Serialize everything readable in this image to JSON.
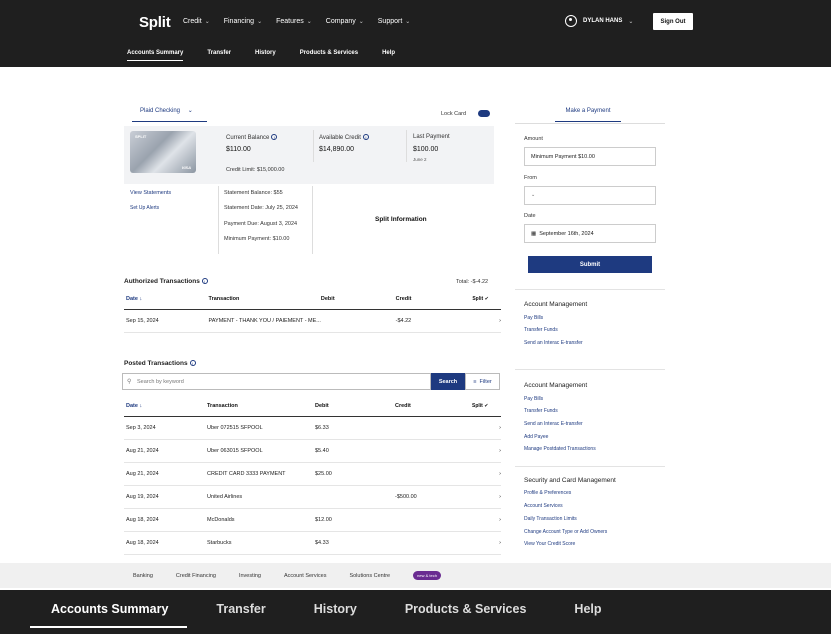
{
  "header": {
    "logo": "Split",
    "nav": [
      "Credit",
      "Financing",
      "Features",
      "Company",
      "Support"
    ],
    "user_name": "DYLAN HANS",
    "sign_out": "Sign Out"
  },
  "subnav": [
    "Accounts Summary",
    "Transfer",
    "History",
    "Products & Services",
    "Help"
  ],
  "account": {
    "selected": "Plaid Checking",
    "lock_card": "Lock Card",
    "card_brand": "SPLIT",
    "card_network": "VISA",
    "current_balance_label": "Current Balance",
    "current_balance": "$110.00",
    "credit_limit": "Credit Limit: $15,000.00",
    "available_credit_label": "Available Credit",
    "available_credit": "$14,890.00",
    "last_payment_label": "Last Payment",
    "last_payment": "$100.00",
    "last_payment_date": "June 2",
    "view_statements": "View Statements",
    "set_up_alerts": "Set Up Alerts",
    "statement_balance": "Statement Balance: $55",
    "statement_date": "Statement Date: July 25, 2024",
    "payment_due": "Payment Due: August 3, 2024",
    "minimum_payment": "Minimum Payment: $10.00",
    "split_information": "Split Information"
  },
  "authorized": {
    "title": "Authorized Transactions",
    "total": "Total: -$-4.22",
    "headers": [
      "Date ↓",
      "Transaction",
      "Debit",
      "Credit",
      "Split ✔"
    ],
    "rows": [
      {
        "date": "Sep 15, 2024",
        "transaction": "PAYMENT - THANK YOU / PAIEMENT - ME...",
        "debit": "",
        "credit": "-$4.22"
      }
    ]
  },
  "posted": {
    "title": "Posted Transactions",
    "search_placeholder": "Search by keyword",
    "search_button": "Search",
    "filter_button": "Filter",
    "headers": [
      "Date ↓",
      "Transaction",
      "Debit",
      "Credit",
      "Split ✔"
    ],
    "rows": [
      {
        "date": "Sep 3, 2024",
        "transaction": "Uber 072515 SFPOOL",
        "debit": "$6.33",
        "credit": ""
      },
      {
        "date": "Aug 21, 2024",
        "transaction": "Uber 063015 SFPOOL",
        "debit": "$5.40",
        "credit": ""
      },
      {
        "date": "Aug 21, 2024",
        "transaction": "CREDIT CARD 3333 PAYMENT",
        "debit": "$25.00",
        "credit": ""
      },
      {
        "date": "Aug 19, 2024",
        "transaction": "United Airlines",
        "debit": "",
        "credit": "-$500.00"
      },
      {
        "date": "Aug 18, 2024",
        "transaction": "McDonalds",
        "debit": "$12.00",
        "credit": ""
      },
      {
        "date": "Aug 18, 2024",
        "transaction": "Starbucks",
        "debit": "$4.33",
        "credit": ""
      }
    ]
  },
  "payment": {
    "tab": "Make a Payment",
    "amount_label": "Amount",
    "amount_value": "Minimum Payment $10.00",
    "from_label": "From",
    "from_value": "",
    "date_label": "Date",
    "date_value": "September 16th, 2024",
    "submit": "Submit"
  },
  "side1": {
    "title": "Account Management",
    "links": [
      "Pay Bills",
      "Transfer Funds",
      "Send an Interac E-transfer"
    ]
  },
  "side2": {
    "title": "Account Management",
    "links": [
      "Pay Bills",
      "Transfer Funds",
      "Send an Interac E-transfer",
      "Add Payee",
      "Manage Postdated Transactions"
    ]
  },
  "side3": {
    "title": "Security and Card Management",
    "links": [
      "Profile & Preferences",
      "Account Services",
      "Daily Transaction Limits",
      "Change Account Type or Add Owners",
      "View Your Credit Score"
    ]
  },
  "footer_links": [
    "Banking",
    "Credit Financing",
    "Investing",
    "Account Services",
    "Solutions Centre"
  ],
  "footer_badge": "new & tech",
  "bottom_nav": [
    "Accounts Summary",
    "Transfer",
    "History",
    "Products & Services",
    "Help"
  ]
}
